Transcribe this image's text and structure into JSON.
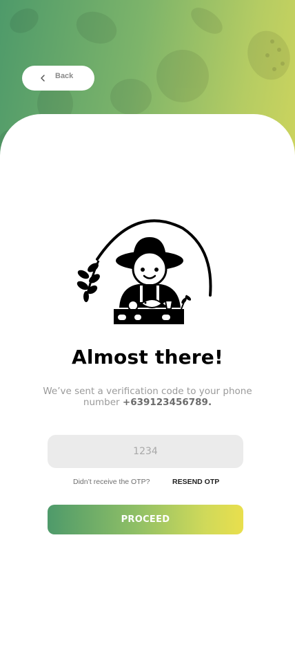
{
  "header": {
    "back_label": "Back",
    "gradient": [
      "#4e9a6a",
      "#cdd45d"
    ]
  },
  "main": {
    "title": "Almost there!",
    "subtitle_text": "We’ve sent a verification code to your phone number ",
    "phone_number": "+639123456789.",
    "otp_placeholder": "1234",
    "otp_value": "",
    "resend_question": "Didn’t receive the OTP?",
    "resend_label": "RESEND OTP",
    "proceed_label": "PROCEED",
    "proceed_gradient": [
      "#4e9a6a",
      "#e9df4d"
    ],
    "illustration_icon": "farmer-icon"
  }
}
